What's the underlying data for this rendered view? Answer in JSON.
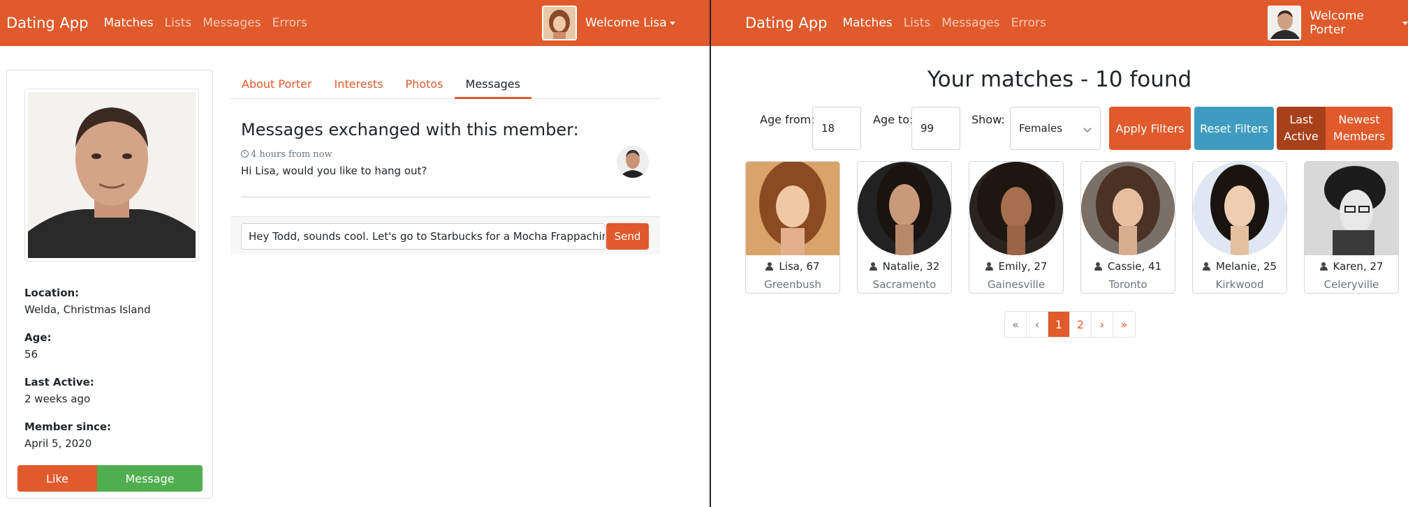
{
  "left": {
    "navbar": {
      "brand": "Dating App",
      "links": [
        "Matches",
        "Lists",
        "Messages",
        "Errors"
      ],
      "active_link": "Matches",
      "welcome": "Welcome Lisa"
    },
    "member": {
      "details": [
        {
          "label": "Location:",
          "value": "Welda, Christmas Island"
        },
        {
          "label": "Age:",
          "value": "56"
        },
        {
          "label": "Last Active:",
          "value": "2 weeks ago"
        },
        {
          "label": "Member since:",
          "value": "April 5, 2020"
        }
      ],
      "like_label": "Like",
      "message_label": "Message"
    },
    "tabs": [
      "About Porter",
      "Interests",
      "Photos",
      "Messages"
    ],
    "active_tab": "Messages",
    "messages": {
      "heading": "Messages exchanged with this member:",
      "items": [
        {
          "time": "4 hours from now",
          "text": "Hi Lisa, would you like to hang out?"
        }
      ],
      "input_value": "Hey Todd, sounds cool. Let's go to Starbucks for a Mocha Frappachino",
      "send_label": "Send"
    }
  },
  "right": {
    "navbar": {
      "brand": "Dating App",
      "links": [
        "Matches",
        "Lists",
        "Messages",
        "Errors"
      ],
      "active_link": "Matches",
      "welcome": "Welcome Porter"
    },
    "title": "Your matches - 10 found",
    "filters": {
      "age_from_label": "Age from:",
      "age_from": "18",
      "age_to_label": "Age to:",
      "age_to": "99",
      "show_label": "Show:",
      "show_value": "Females",
      "apply_label": "Apply Filters",
      "reset_label": "Reset Filters",
      "sort_last_active": "Last Active",
      "sort_newest": "Newest Members",
      "active_sort": "Last Active"
    },
    "matches": [
      {
        "name": "Lisa, 67",
        "city": "Greenbush"
      },
      {
        "name": "Natalie, 32",
        "city": "Sacramento"
      },
      {
        "name": "Emily, 27",
        "city": "Gainesville"
      },
      {
        "name": "Cassie, 41",
        "city": "Toronto"
      },
      {
        "name": "Melanie, 25",
        "city": "Kirkwood"
      },
      {
        "name": "Karen, 27",
        "city": "Celeryville"
      }
    ],
    "pagination": [
      "«",
      "‹",
      "1",
      "2",
      "›",
      "»"
    ],
    "current_page": "1"
  },
  "colors": {
    "primary": "#e05a2b",
    "primary_dark": "#a8401b",
    "success": "#4fae4d",
    "info": "#3f9cc0"
  }
}
